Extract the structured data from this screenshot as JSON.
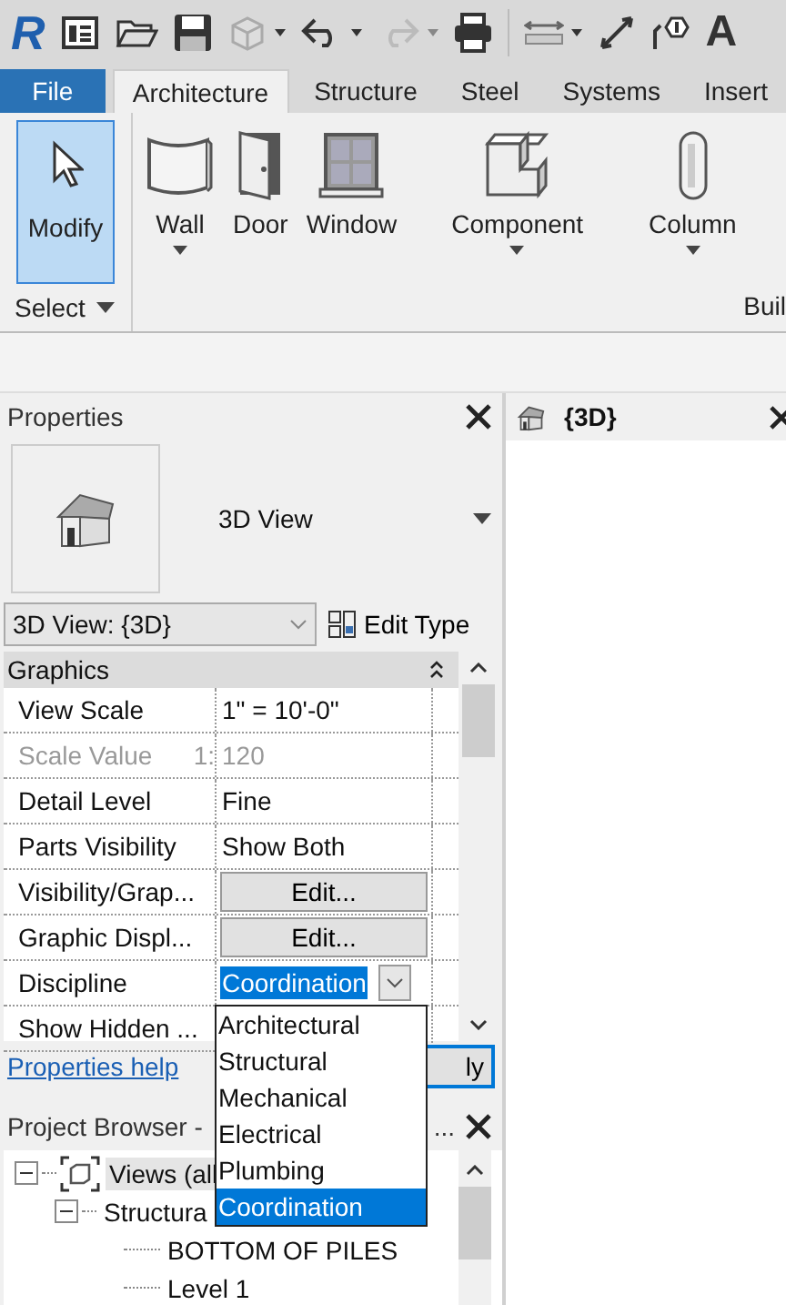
{
  "quick_access_toolbar": {
    "logo": "R",
    "text_tool": "A"
  },
  "tabs": [
    {
      "label": "File",
      "kind": "file",
      "selected": false
    },
    {
      "label": "Architecture",
      "kind": "tab",
      "selected": true
    },
    {
      "label": "Structure",
      "kind": "tab",
      "selected": false
    },
    {
      "label": "Steel",
      "kind": "tab",
      "selected": false
    },
    {
      "label": "Systems",
      "kind": "tab",
      "selected": false
    },
    {
      "label": "Insert",
      "kind": "tab",
      "selected": false
    }
  ],
  "ribbon": {
    "panels": [
      {
        "label": "Select",
        "menu": true,
        "tools": [
          {
            "label": "Modify",
            "kind": "modify",
            "selected": true,
            "dropdown": false
          }
        ]
      },
      {
        "label": "Buil",
        "menu": false,
        "tools": [
          {
            "label": "Wall",
            "kind": "wall",
            "selected": false,
            "dropdown": true
          },
          {
            "label": "Door",
            "kind": "door",
            "selected": false,
            "dropdown": false
          },
          {
            "label": "Window",
            "kind": "window",
            "selected": false,
            "dropdown": false
          },
          {
            "label": "Component",
            "kind": "component",
            "selected": false,
            "dropdown": true
          },
          {
            "label": "Column",
            "kind": "column",
            "selected": false,
            "dropdown": true
          }
        ]
      }
    ]
  },
  "properties": {
    "title": "Properties",
    "type_name": "3D View",
    "instance": "3D View: {3D}",
    "edit_type": "Edit Type",
    "group": "Graphics",
    "rows": [
      {
        "name": "View Scale",
        "kind": "text",
        "value": "1\" = 10'-0\"",
        "disabled": false
      },
      {
        "name": "Scale Value",
        "prefix": "1:",
        "kind": "text",
        "value": "120",
        "disabled": true
      },
      {
        "name": "Detail Level",
        "kind": "text",
        "value": "Fine",
        "disabled": false
      },
      {
        "name": "Parts Visibility",
        "kind": "text",
        "value": "Show Both",
        "disabled": false
      },
      {
        "name": "Visibility/Grap...",
        "kind": "button",
        "value": "Edit...",
        "disabled": false
      },
      {
        "name": "Graphic Displ...",
        "kind": "button",
        "value": "Edit...",
        "disabled": false
      },
      {
        "name": "Discipline",
        "kind": "dropdown",
        "value": "Coordination",
        "disabled": false
      },
      {
        "name": "Show Hidden ...",
        "disabled": false
      }
    ],
    "help": "Properties help",
    "apply": "ly"
  },
  "discipline_options": [
    {
      "label": "Architectural",
      "selected": false
    },
    {
      "label": "Structural",
      "selected": false
    },
    {
      "label": "Mechanical",
      "selected": false
    },
    {
      "label": "Electrical",
      "selected": false
    },
    {
      "label": "Plumbing",
      "selected": false
    },
    {
      "label": "Coordination",
      "selected": true
    }
  ],
  "view_tab": {
    "title": "{3D}"
  },
  "project_browser": {
    "title": "Project Browser -",
    "ellipsis": "...",
    "tree": [
      {
        "label": "Views (all",
        "selected": true,
        "expanded": true,
        "children": [
          {
            "label": "Structura",
            "selected": false,
            "expanded": true,
            "children": [
              {
                "label": "BOTTOM OF PILES",
                "selected": false
              },
              {
                "label": "Level 1",
                "selected": false
              }
            ]
          }
        ]
      }
    ]
  }
}
